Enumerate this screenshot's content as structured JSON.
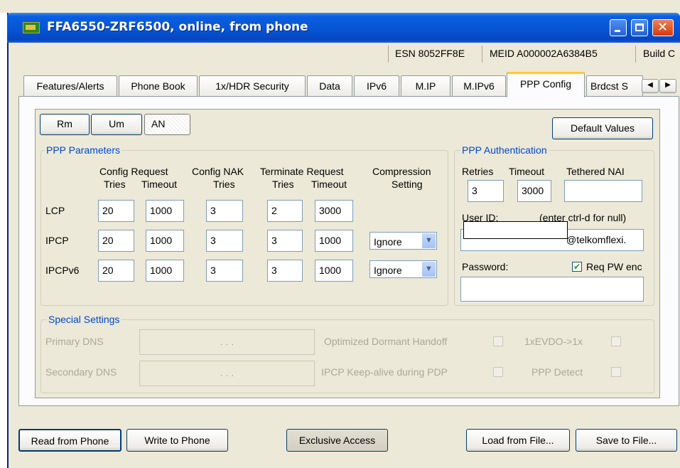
{
  "window": {
    "title": "FFA6550-ZRF6500, online, from phone"
  },
  "info_bar": {
    "esn": "ESN 8052FF8E",
    "meid": "MEID A000002A6384B5",
    "build": "Build C"
  },
  "tabs": [
    "Features/Alerts",
    "Phone Book",
    "1x/HDR Security",
    "Data",
    "IPv6",
    "M.IP",
    "M.IPv6",
    "PPP Config",
    "Brdcst S"
  ],
  "mode_buttons": [
    "Rm",
    "Um",
    "AN"
  ],
  "default_values_label": "Default Values",
  "ppp_parameters": {
    "legend": "PPP Parameters",
    "headers": {
      "config_request": "Config Request",
      "config_nak": "Config NAK",
      "terminate_request": "Terminate Request",
      "compression": "Compression",
      "tries": "Tries",
      "timeout": "Timeout",
      "setting": "Setting"
    },
    "rows": [
      {
        "label": "LCP",
        "cfg_tries": "20",
        "cfg_timeout": "1000",
        "nak_tries": "3",
        "term_tries": "2",
        "term_timeout": "3000",
        "compression": ""
      },
      {
        "label": "IPCP",
        "cfg_tries": "20",
        "cfg_timeout": "1000",
        "nak_tries": "3",
        "term_tries": "3",
        "term_timeout": "1000",
        "compression": "Ignore"
      },
      {
        "label": "IPCPv6",
        "cfg_tries": "20",
        "cfg_timeout": "1000",
        "nak_tries": "3",
        "term_tries": "3",
        "term_timeout": "1000",
        "compression": "Ignore"
      }
    ]
  },
  "ppp_auth": {
    "legend": "PPP Authentication",
    "retries_label": "Retries",
    "timeout_label": "Timeout",
    "tethered_label": "Tethered NAI",
    "retries": "3",
    "timeout": "3000",
    "tethered": "",
    "user_id_label": "User ID:",
    "user_id_hint": "(enter ctrl-d for null)",
    "user_id_value": "@telkomflexi.",
    "password_label": "Password:",
    "req_pw_enc_label": "Req PW enc",
    "req_pw_enc_checked": true,
    "password": ""
  },
  "special_settings": {
    "legend": "Special Settings",
    "primary_dns_label": "Primary DNS",
    "secondary_dns_label": "Secondary DNS",
    "dns_placeholder": ".     .     .",
    "optimized_dormant_label": "Optimized Dormant Handoff",
    "evdo_label": "1xEVDO->1x",
    "ipcp_keepalive_label": "IPCP Keep-alive during PDP",
    "ppp_detect_label": "PPP Detect"
  },
  "footer": {
    "read": "Read from Phone",
    "write": "Write to Phone",
    "exclusive": "Exclusive Access",
    "load": "Load from File...",
    "save": "Save to File..."
  }
}
